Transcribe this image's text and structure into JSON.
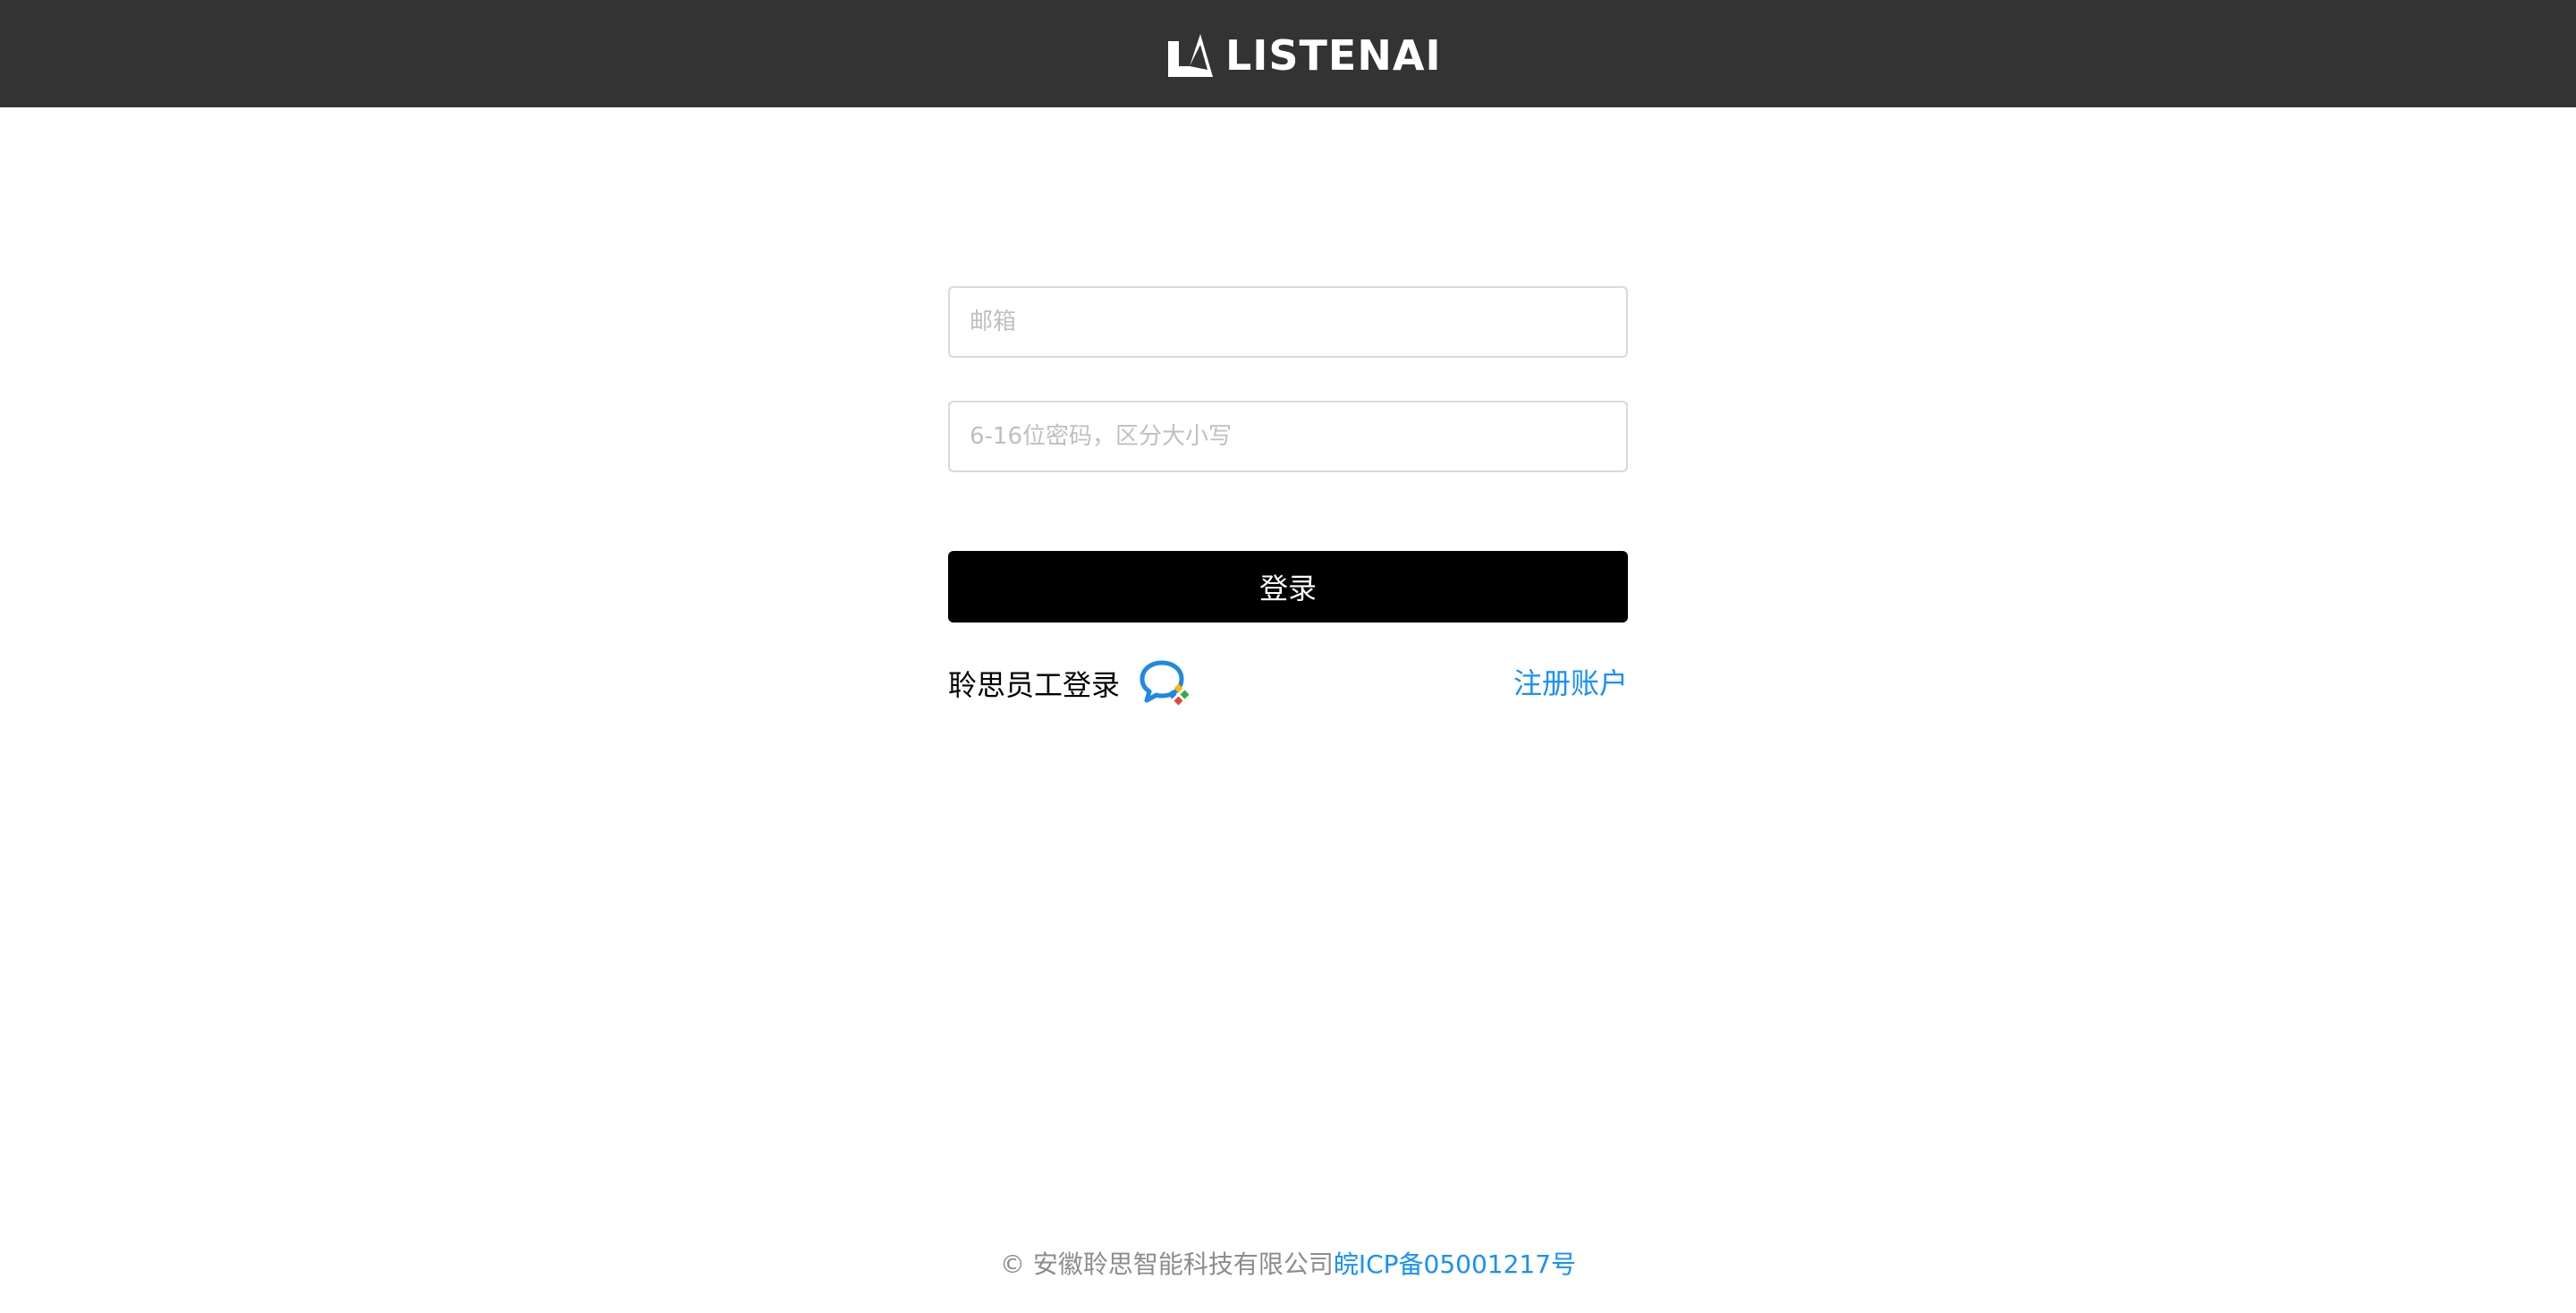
{
  "header": {
    "brand_name": "LISTENAI",
    "background_color": "#333333"
  },
  "login_form": {
    "email_placeholder": "邮箱",
    "email_value": "",
    "password_placeholder": "6-16位密码，区分大小写",
    "password_value": "",
    "submit_label": "登录",
    "submit_color": "#000000"
  },
  "alt_login": {
    "staff_login_label": "聆思员工登录",
    "staff_login_icon": "chat-bubble-icon",
    "register_label": "注册账户",
    "link_color": "#1890ff"
  },
  "footer": {
    "copyright": "© 安徽聆思智能科技有限公司",
    "icp_link": "皖ICP备05001217号"
  }
}
